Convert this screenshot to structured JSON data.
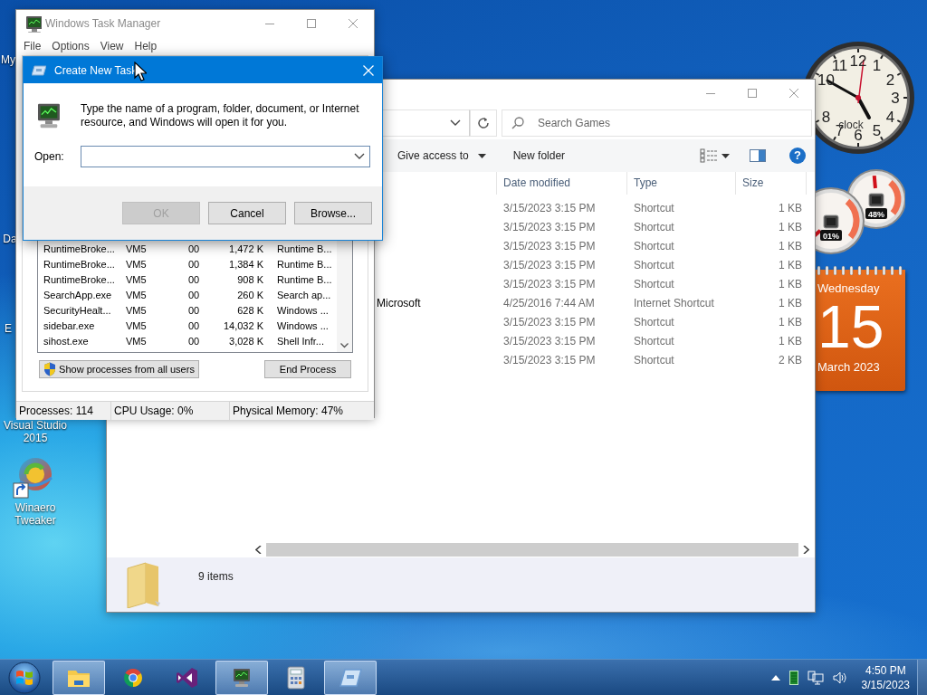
{
  "desktop_icons": [
    {
      "kind": "label",
      "label": "My"
    },
    {
      "kind": "label",
      "label": "Da"
    },
    {
      "kind": "label",
      "label": "E"
    },
    {
      "kind": "label",
      "label": "Visual Studio 2015"
    },
    {
      "kind": "shortcut",
      "label": "Winaero Tweaker"
    }
  ],
  "gadgets": {
    "clock": {
      "label": "clock",
      "numbers": [
        "12",
        "1",
        "2",
        "3",
        "4",
        "5",
        "6",
        "7",
        "8",
        "10",
        "11"
      ]
    },
    "gauges": [
      {
        "reading": "48%"
      },
      {
        "reading": "01%"
      }
    ],
    "calendar": {
      "weekday": "Wednesday",
      "day": "15",
      "month_year": "March 2023"
    }
  },
  "explorer": {
    "search": {
      "placeholder": "Search Games"
    },
    "toolbar": [
      {
        "kind": "menu",
        "label": "Give access to"
      },
      {
        "kind": "button",
        "label": "New folder"
      }
    ],
    "help": "?",
    "columns": [
      "Date modified",
      "Type",
      "Size"
    ],
    "rows": [
      {
        "date": "3/15/2023 3:15 PM",
        "type": "Shortcut",
        "size": "1 KB"
      },
      {
        "date": "3/15/2023 3:15 PM",
        "type": "Shortcut",
        "size": "1 KB"
      },
      {
        "date": "3/15/2023 3:15 PM",
        "type": "Shortcut",
        "size": "1 KB"
      },
      {
        "date": "3/15/2023 3:15 PM",
        "type": "Shortcut",
        "size": "1 KB"
      },
      {
        "date": "3/15/2023 3:15 PM",
        "type": "Shortcut",
        "size": "1 KB"
      },
      {
        "name": "Microsoft",
        "date": "4/25/2016 7:44 AM",
        "type": "Internet Shortcut",
        "size": "1 KB"
      },
      {
        "date": "3/15/2023 3:15 PM",
        "type": "Shortcut",
        "size": "1 KB"
      },
      {
        "date": "3/15/2023 3:15 PM",
        "type": "Shortcut",
        "size": "1 KB"
      },
      {
        "date": "3/15/2023 3:15 PM",
        "type": "Shortcut",
        "size": "2 KB"
      }
    ],
    "status": "9 items"
  },
  "task_manager": {
    "title": "Windows Task Manager",
    "menu": [
      "File",
      "Options",
      "View",
      "Help"
    ],
    "processes": [
      {
        "name": "RuntimeBroke...",
        "user": "VM5",
        "cpu": "00",
        "memory": "1,472 K",
        "description": "Runtime B..."
      },
      {
        "name": "RuntimeBroke...",
        "user": "VM5",
        "cpu": "00",
        "memory": "1,384 K",
        "description": "Runtime B..."
      },
      {
        "name": "RuntimeBroke...",
        "user": "VM5",
        "cpu": "00",
        "memory": "908 K",
        "description": "Runtime B..."
      },
      {
        "name": "SearchApp.exe",
        "user": "VM5",
        "cpu": "00",
        "memory": "260 K",
        "description": "Search ap..."
      },
      {
        "name": "SecurityHealt...",
        "user": "VM5",
        "cpu": "00",
        "memory": "628 K",
        "description": "Windows ..."
      },
      {
        "name": "sidebar.exe",
        "user": "VM5",
        "cpu": "00",
        "memory": "14,032 K",
        "description": "Windows ..."
      },
      {
        "name": "sihost.exe",
        "user": "VM5",
        "cpu": "00",
        "memory": "3,028 K",
        "description": "Shell Infr..."
      }
    ],
    "show_all_button": "Show processes from all users",
    "end_button": "End Process",
    "status": [
      "Processes: 114",
      "CPU Usage: 0%",
      "Physical Memory: 47%"
    ]
  },
  "dialog": {
    "title": "Create New Task",
    "message": "Type the name of a program, folder, document, or Internet resource, and Windows will open it for you.",
    "open_label": "Open:",
    "buttons": [
      {
        "label": "OK",
        "disabled": true
      },
      {
        "label": "Cancel",
        "disabled": false
      },
      {
        "label": "Browse...",
        "disabled": false
      }
    ]
  },
  "taskbar": {
    "apps": [
      {
        "kind": "explorer",
        "running": true
      },
      {
        "kind": "chrome",
        "running": false
      },
      {
        "kind": "vs",
        "running": false
      },
      {
        "kind": "taskmgr",
        "running": true
      },
      {
        "kind": "calc",
        "running": false
      },
      {
        "kind": "run",
        "running": true
      }
    ],
    "time": "4:50 PM",
    "date": "3/15/2023"
  }
}
